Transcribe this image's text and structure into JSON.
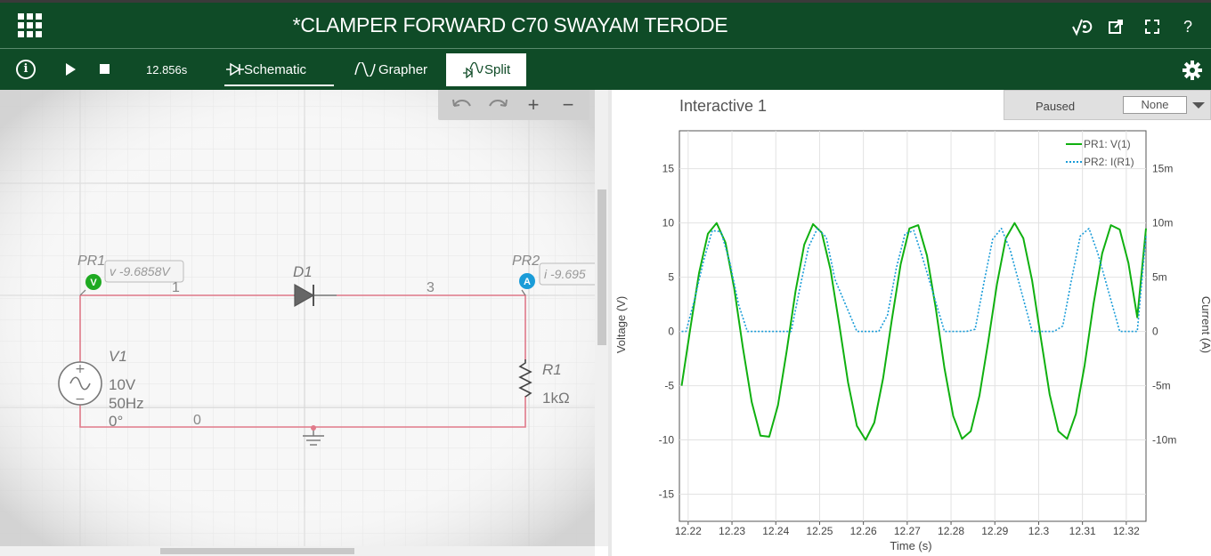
{
  "window": {
    "title": "*CLAMPER FORWARD C70 SWAYAM TERODE",
    "icons": [
      "apps-grid-icon",
      "simulation-icon",
      "pop-out-icon",
      "fullscreen-icon",
      "help-icon"
    ],
    "help_label": "?"
  },
  "toolbar": {
    "info_label": "i",
    "elapsed_time": "12.856s",
    "tabs": [
      {
        "label": "Schematic",
        "active": false
      },
      {
        "label": "Grapher",
        "active": false
      },
      {
        "label": "Split",
        "active": true
      }
    ]
  },
  "zoom_controls": {
    "plus": "+",
    "minus": "−"
  },
  "schematic": {
    "probe1": {
      "name": "PR1",
      "badge": "V",
      "readout": "v -9.6858V"
    },
    "probe2": {
      "name": "PR2",
      "badge": "A",
      "readout": "i -9.695"
    },
    "diode": {
      "name": "D1"
    },
    "source": {
      "name": "V1",
      "amplitude": "10V",
      "frequency": "50Hz",
      "phase": "0°"
    },
    "resistor": {
      "name": "R1",
      "value": "1kΩ"
    },
    "nodes": {
      "n1": "1",
      "n3": "3",
      "n0": "0"
    }
  },
  "grapher": {
    "title": "Interactive 1",
    "status": "Paused",
    "trigger": "None"
  },
  "chart_data": {
    "type": "line",
    "title": "",
    "xlabel": "Time (s)",
    "ylabel": "Voltage (V)",
    "y2label": "Current (A)",
    "xlim": [
      12.218,
      12.3245
    ],
    "ylim": [
      -17.5,
      18.5
    ],
    "y2lim": [
      -0.0175,
      0.0185
    ],
    "x_ticks": [
      "12.22",
      "12.23",
      "12.24",
      "12.25",
      "12.26",
      "12.27",
      "12.28",
      "12.29",
      "12.3",
      "12.31",
      "12.32"
    ],
    "y_ticks": [
      15,
      10,
      5,
      0,
      -5,
      -10,
      -15
    ],
    "y2_ticks": [
      "15m",
      "10m",
      "5m",
      "0",
      "-5m",
      "-10m"
    ],
    "grid": true,
    "legend_position": "top-right",
    "series": [
      {
        "name": "PR1: V(1)",
        "axis": "left",
        "color": "#10b010",
        "style": "solid",
        "x": [
          12.2185,
          12.2205,
          12.2225,
          12.2245,
          12.2265,
          12.2285,
          12.2305,
          12.2325,
          12.2345,
          12.2365,
          12.2385,
          12.2405,
          12.2425,
          12.2445,
          12.2465,
          12.2485,
          12.2505,
          12.2525,
          12.2545,
          12.2565,
          12.2585,
          12.2605,
          12.2625,
          12.2645,
          12.2665,
          12.2685,
          12.2705,
          12.2725,
          12.2745,
          12.2765,
          12.2785,
          12.2805,
          12.2825,
          12.2845,
          12.2865,
          12.2885,
          12.2905,
          12.2925,
          12.2945,
          12.2965,
          12.2985,
          12.3005,
          12.3025,
          12.3045,
          12.3065,
          12.3085,
          12.3105,
          12.3125,
          12.3145,
          12.3165,
          12.3185,
          12.3205,
          12.3225,
          12.3245
        ],
        "y": [
          -5.0,
          0.3,
          5.4,
          9.0,
          10.0,
          8.2,
          4.0,
          -1.5,
          -6.5,
          -9.6,
          -9.7,
          -6.8,
          -1.8,
          3.7,
          8.0,
          9.9,
          9.1,
          5.7,
          0.6,
          -4.7,
          -8.7,
          -10.0,
          -8.4,
          -4.3,
          1.1,
          6.2,
          9.5,
          9.8,
          7.0,
          2.2,
          -3.4,
          -7.8,
          -9.9,
          -9.2,
          -5.9,
          -0.9,
          4.4,
          8.6,
          10.0,
          8.6,
          4.7,
          -0.6,
          -5.8,
          -9.2,
          -9.9,
          -7.6,
          -3.1,
          2.5,
          7.2,
          9.8,
          9.4,
          6.3,
          1.3,
          9.5
        ]
      },
      {
        "name": "PR2: I(R1)",
        "axis": "right",
        "color": "#1a9cd8",
        "style": "dotted",
        "x": [
          12.2185,
          12.2195,
          12.2215,
          12.2235,
          12.2255,
          12.2275,
          12.2295,
          12.2315,
          12.2335,
          12.2385,
          12.2435,
          12.2455,
          12.2475,
          12.2495,
          12.2515,
          12.2535,
          12.2585,
          12.2635,
          12.2655,
          12.2675,
          12.2695,
          12.2715,
          12.2735,
          12.2785,
          12.2835,
          12.2855,
          12.2875,
          12.2895,
          12.2915,
          12.2935,
          12.2985,
          12.3035,
          12.3055,
          12.3075,
          12.3095,
          12.3115,
          12.3135,
          12.3185,
          12.3225,
          12.3245
        ],
        "y": [
          0,
          0,
          0.003,
          0.0065,
          0.0093,
          0.0092,
          0.0064,
          0.0025,
          0,
          0,
          0,
          0.004,
          0.0078,
          0.0095,
          0.0087,
          0.0048,
          0,
          0,
          0.0015,
          0.0058,
          0.009,
          0.0093,
          0.0068,
          0,
          0,
          0.0002,
          0.0045,
          0.0085,
          0.0095,
          0.0075,
          0,
          0,
          0.0005,
          0.0048,
          0.0088,
          0.0095,
          0.0072,
          0,
          0,
          0.0088
        ]
      }
    ]
  }
}
